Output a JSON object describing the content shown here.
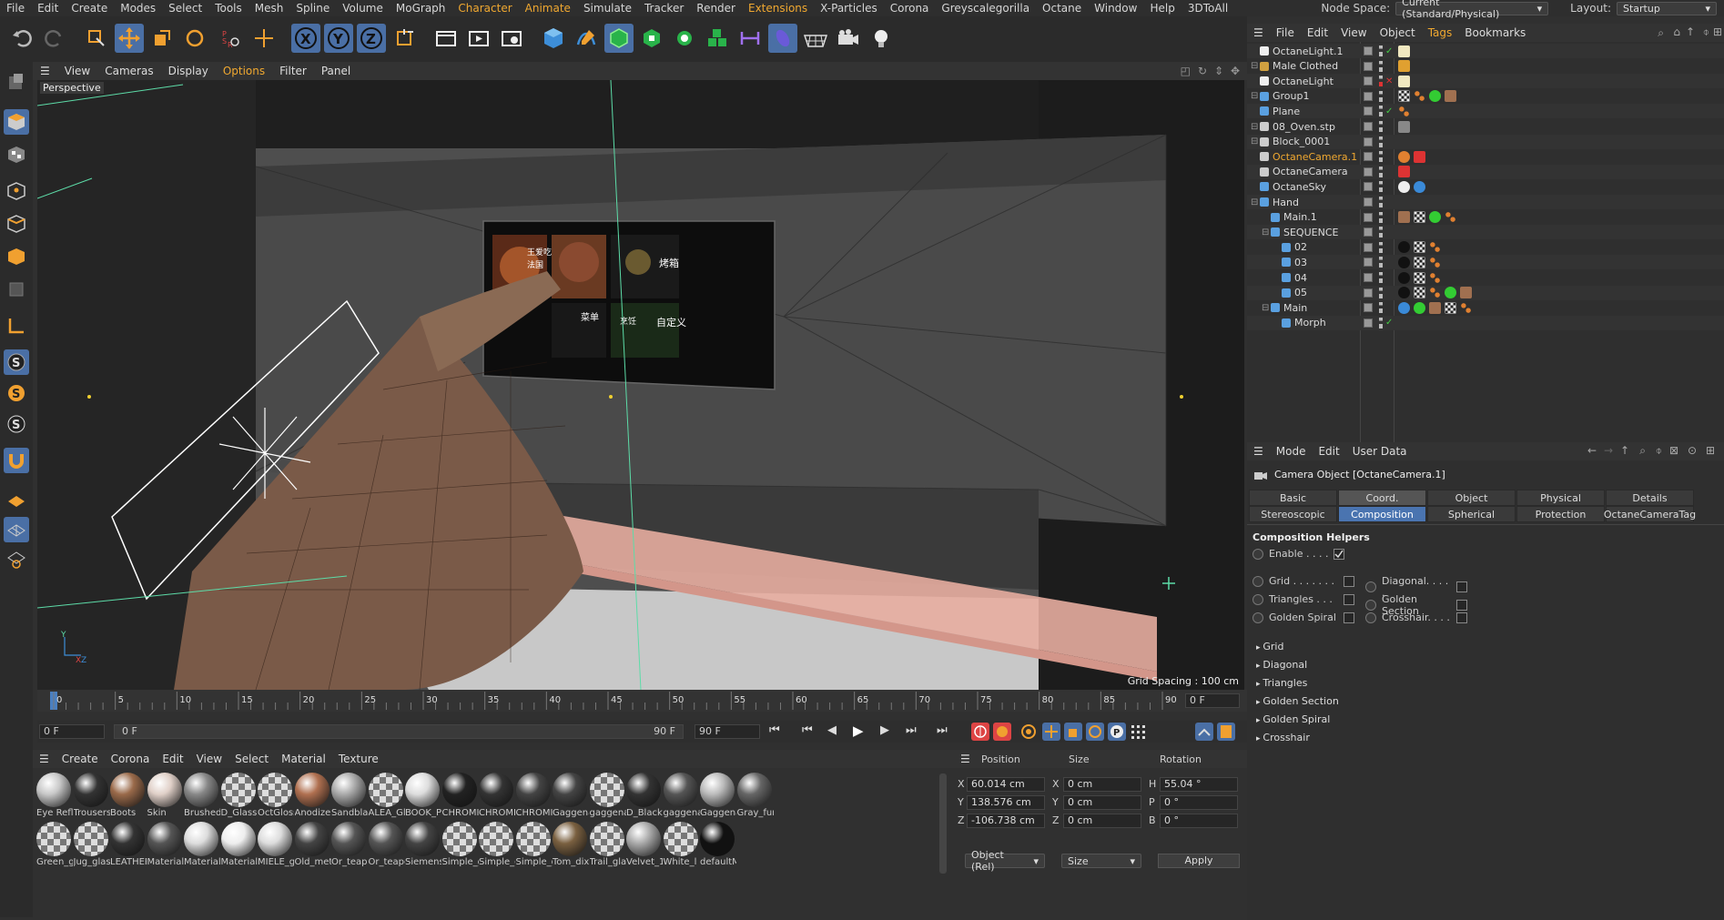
{
  "menubar": {
    "items": [
      "File",
      "Edit",
      "Create",
      "Modes",
      "Select",
      "Tools",
      "Mesh",
      "Spline",
      "Volume",
      "MoGraph",
      "Character",
      "Animate",
      "Simulate",
      "Tracker",
      "Render",
      "Extensions",
      "X-Particles",
      "Corona",
      "Greyscalegorilla",
      "Octane",
      "Window",
      "Help",
      "3DToAll"
    ],
    "node_space_label": "Node Space:",
    "node_space_value": "Current (Standard/Physical)",
    "layout_label": "Layout:",
    "layout_value": "Startup"
  },
  "viewport": {
    "menu": [
      "View",
      "Cameras",
      "Display",
      "Options",
      "Filter",
      "Panel"
    ],
    "camera_label": "Perspective",
    "grid_spacing": "Grid Spacing : 100 cm",
    "screen_tiles": [
      "王爱吃",
      "法国",
      "烤箱",
      "菜单",
      "烹饪",
      "自定义"
    ]
  },
  "timeline": {
    "ticks": [
      "0",
      "5",
      "10",
      "15",
      "20",
      "25",
      "30",
      "35",
      "40",
      "45",
      "50",
      "55",
      "60",
      "65",
      "70",
      "75",
      "80",
      "85",
      "90"
    ],
    "current_frame": "0 F"
  },
  "transport": {
    "start": "0 F",
    "range_start": "0 F",
    "range_end": "90 F",
    "end": "90 F"
  },
  "material_manager": {
    "menu": [
      "Create",
      "Corona",
      "Edit",
      "View",
      "Select",
      "Material",
      "Texture"
    ],
    "row1": [
      "Eye Refle",
      "Trousers",
      "Boots",
      "Skin",
      "Brushed",
      "D_Glass",
      "OctGloss",
      "Anodize",
      "Sandblas",
      "ALEA_Gl",
      "BOOK_P",
      "CHROMI",
      "CHROMI",
      "CHROMI",
      "Gaggena",
      "gaggena",
      "D_BlackP",
      "gaggena",
      "Gaggena",
      "Gray_fur"
    ],
    "row2": [
      "Green_g",
      "Jug_glas",
      "LEATHER",
      "Material",
      "Material",
      "Material",
      "MIELE_g",
      "Old_met",
      "Or_teapo",
      "Or_teapo",
      "Siemens",
      "Simple_g",
      "Simple_g",
      "Simple_g",
      "Tom_dix",
      "Trail_gla",
      "Velvet_1",
      "White_l",
      "defaultM"
    ]
  },
  "coordinates": {
    "headers": [
      "Position",
      "Size",
      "Rotation"
    ],
    "rows": [
      {
        "axis": "X",
        "pos": "60.014 cm",
        "saxis": "X",
        "size": "0 cm",
        "raxis": "H",
        "rot": "55.04 °"
      },
      {
        "axis": "Y",
        "pos": "138.576 cm",
        "saxis": "Y",
        "size": "0 cm",
        "raxis": "P",
        "rot": "0 °"
      },
      {
        "axis": "Z",
        "pos": "-106.738 cm",
        "saxis": "Z",
        "size": "0 cm",
        "raxis": "B",
        "rot": "0 °"
      }
    ],
    "mode": "Object (Rel)",
    "size_mode": "Size",
    "apply": "Apply"
  },
  "object_manager": {
    "menu": [
      "File",
      "Edit",
      "View",
      "Object",
      "Tags",
      "Bookmarks"
    ],
    "objects": [
      {
        "name": "OctaneLight.1",
        "indent": 0
      },
      {
        "name": "Male Clothed",
        "indent": 0
      },
      {
        "name": "OctaneLight",
        "indent": 0
      },
      {
        "name": "Group1",
        "indent": 0
      },
      {
        "name": "Plane",
        "indent": 0
      },
      {
        "name": "08_Oven.stp",
        "indent": 0
      },
      {
        "name": "Block_0001",
        "indent": 0
      },
      {
        "name": "OctaneCamera.1",
        "indent": 0,
        "highlight": true
      },
      {
        "name": "OctaneCamera",
        "indent": 0
      },
      {
        "name": "OctaneSky",
        "indent": 0
      },
      {
        "name": "Hand",
        "indent": 0
      },
      {
        "name": "Main.1",
        "indent": 1
      },
      {
        "name": "SEQUENCE",
        "indent": 1
      },
      {
        "name": "02",
        "indent": 2
      },
      {
        "name": "03",
        "indent": 2
      },
      {
        "name": "04",
        "indent": 2
      },
      {
        "name": "05",
        "indent": 2
      },
      {
        "name": "Main",
        "indent": 1
      },
      {
        "name": "Morph",
        "indent": 2
      }
    ]
  },
  "attributes": {
    "menu": [
      "Mode",
      "Edit",
      "User Data"
    ],
    "title": "Camera Object [OctaneCamera.1]",
    "tabs_row1": [
      "Basic",
      "Coord.",
      "Object",
      "Physical",
      "Details"
    ],
    "tabs_row2": [
      "Stereoscopic",
      "Composition",
      "Spherical",
      "Protection",
      "OctaneCameraTag"
    ],
    "active_tab": "Composition",
    "section": "Composition Helpers",
    "enable_label": "Enable . . . .",
    "left_opts": [
      "Grid . . . . . . .",
      "Triangles . . .",
      "Golden Spiral"
    ],
    "right_opts": [
      "Diagonal. . . . .",
      "Golden Section",
      "Crosshair. . . ."
    ],
    "folds": [
      "Grid",
      "Diagonal",
      "Triangles",
      "Golden Section",
      "Golden Spiral",
      "Crosshair"
    ]
  }
}
